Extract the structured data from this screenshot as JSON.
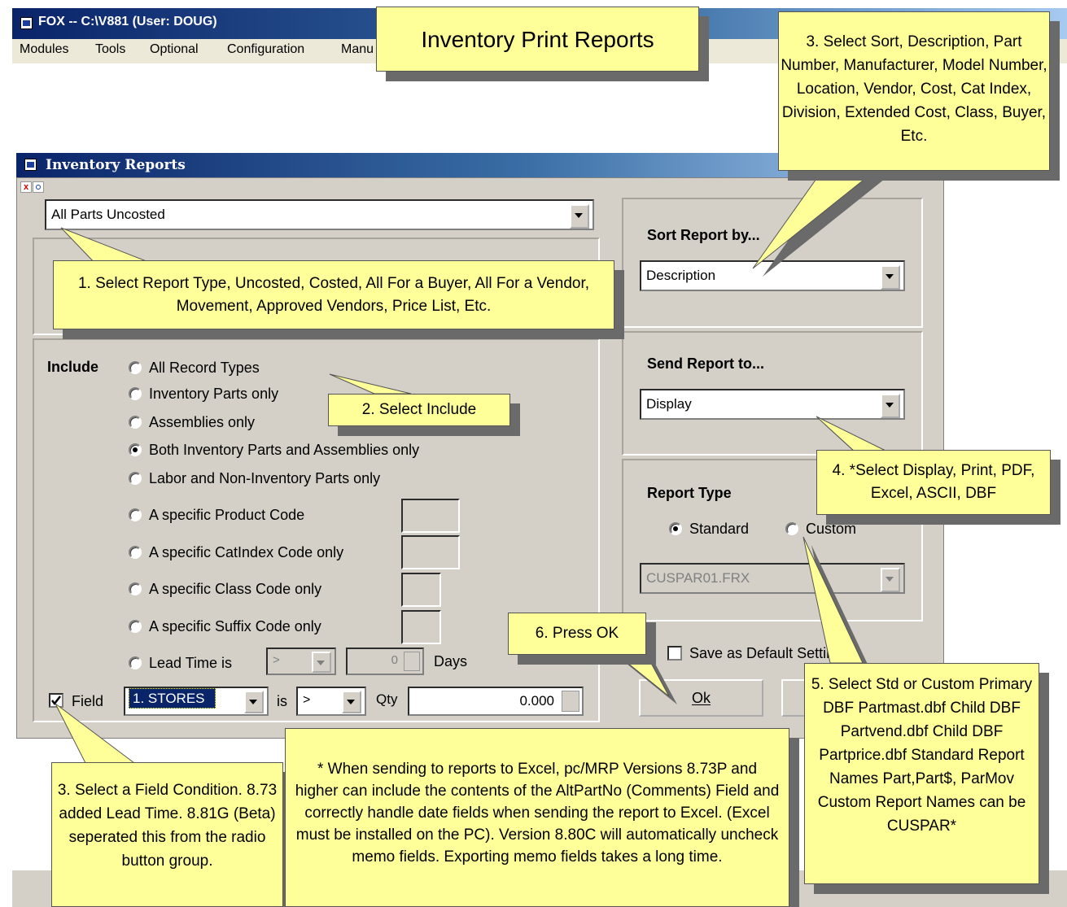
{
  "app": {
    "window_title": "FOX -- C:\\V881  (User: DOUG)",
    "menu": [
      "Modules",
      "Tools",
      "Optional",
      "Configuration",
      "Manu"
    ]
  },
  "dialog": {
    "title": "Inventory Reports",
    "close_label": "x",
    "report_type_value": "All Parts Uncosted",
    "include": {
      "label": "Include",
      "options": [
        {
          "label": "All Record Types",
          "selected": false
        },
        {
          "label": "Inventory Parts only",
          "selected": false
        },
        {
          "label": "Assemblies only",
          "selected": false
        },
        {
          "label": "Both Inventory Parts and Assemblies only",
          "selected": true
        },
        {
          "label": "Labor and Non-Inventory Parts only",
          "selected": false
        },
        {
          "label": "A specific Product Code",
          "selected": false
        },
        {
          "label": "A specific CatIndex Code only",
          "selected": false
        },
        {
          "label": "A specific Class Code only",
          "selected": false
        },
        {
          "label": "A specific Suffix Code only",
          "selected": false
        },
        {
          "label": "Lead Time is",
          "selected": false
        }
      ],
      "lead_time_operator": ">",
      "lead_time_value": "0",
      "lead_time_unit": "Days"
    },
    "field_condition": {
      "checkbox_label": "Field",
      "checked": true,
      "field_value": "1. STORES",
      "is_label": "is",
      "operator": ">",
      "qty_label": "Qty",
      "qty_value": "0.000"
    },
    "sort": {
      "label": "Sort Report by...",
      "value": "Description"
    },
    "send": {
      "label": "Send Report to...",
      "value": "Display"
    },
    "report_type": {
      "label": "Report Type",
      "standard_label": "Standard",
      "custom_label": "Custom",
      "standard_selected": true,
      "custom_file": "CUSPAR01.FRX"
    },
    "save_default_label": "Save as Default Settings",
    "ok_label": "Ok"
  },
  "callouts": {
    "title": "Inventory Print Reports",
    "c1": "1. Select Report Type, Uncosted, Costed, All For a Buyer, All For a Vendor, Movement, Approved Vendors, Price List, Etc.",
    "c2": "2. Select Include",
    "c3_top": "3. Select Sort, Description, Part Number, Manufacturer, Model Number, Location, Vendor, Cost, Cat Index, Division, Extended Cost, Class, Buyer, Etc.",
    "c3_bottom": "3. Select a Field Condition. 8.73 added Lead Time.  8.81G (Beta) seperated this from the radio button group.",
    "c4": "4. *Select Display, Print, PDF, Excel, ASCII, DBF",
    "c5": "5. Select Std or Custom Primary DBF Partmast.dbf Child DBF Partvend.dbf Child DBF Partprice.dbf Standard Report Names Part,Part$, ParMov Custom Report Names can be CUSPAR*",
    "c6": "6. Press OK",
    "note": "* When sending to reports to Excel, pc/MRP Versions 8.73P and higher can include the contents of the AltPartNo (Comments) Field and correctly handle date fields when sending the report to Excel.  (Excel must be installed on the PC).  Version 8.80C will automatically uncheck memo fields.  Exporting memo fields takes a long time."
  },
  "colors": {
    "callout_bg": "#ffff99",
    "dialog_bg": "#d4d0c8",
    "titlebar": "#0a246a",
    "selected_field": "#0a246a"
  }
}
